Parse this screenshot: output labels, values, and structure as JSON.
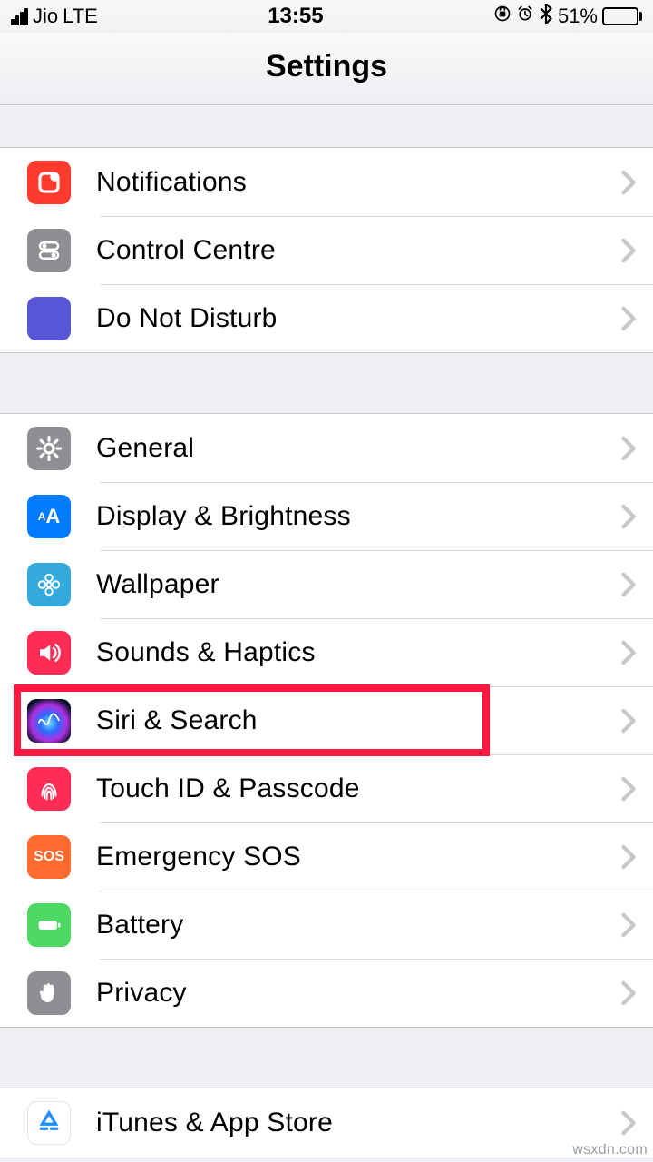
{
  "status": {
    "carrier": "Jio",
    "network": "LTE",
    "time": "13:55",
    "orientation_lock": true,
    "alarm": true,
    "bluetooth": true,
    "battery_pct": "51%"
  },
  "header": {
    "title": "Settings"
  },
  "groups": [
    {
      "rows": [
        {
          "id": "notifications",
          "label": "Notifications",
          "icon": "notifications-icon",
          "icon_bg": "bg-red"
        },
        {
          "id": "control-centre",
          "label": "Control Centre",
          "icon": "toggles-icon",
          "icon_bg": "bg-gray"
        },
        {
          "id": "do-not-disturb",
          "label": "Do Not Disturb",
          "icon": "moon-icon",
          "icon_bg": "bg-indigo"
        }
      ]
    },
    {
      "rows": [
        {
          "id": "general",
          "label": "General",
          "icon": "gear-icon",
          "icon_bg": "bg-gray"
        },
        {
          "id": "display-brightness",
          "label": "Display & Brightness",
          "icon": "aa-icon",
          "icon_bg": "bg-blue"
        },
        {
          "id": "wallpaper",
          "label": "Wallpaper",
          "icon": "flower-icon",
          "icon_bg": "bg-cyan"
        },
        {
          "id": "sounds-haptics",
          "label": "Sounds & Haptics",
          "icon": "speaker-icon",
          "icon_bg": "bg-pink"
        },
        {
          "id": "siri-search",
          "label": "Siri & Search",
          "icon": "siri-icon",
          "icon_bg": "bg-siri",
          "highlighted": true
        },
        {
          "id": "touchid-passcode",
          "label": "Touch ID & Passcode",
          "icon": "fingerprint-icon",
          "icon_bg": "bg-pink"
        },
        {
          "id": "emergency-sos",
          "label": "Emergency SOS",
          "icon": "sos-icon",
          "icon_bg": "bg-sos",
          "icon_text": "SOS"
        },
        {
          "id": "battery",
          "label": "Battery",
          "icon": "battery-icon",
          "icon_bg": "bg-green"
        },
        {
          "id": "privacy",
          "label": "Privacy",
          "icon": "hand-icon",
          "icon_bg": "bg-gray"
        }
      ]
    },
    {
      "rows": [
        {
          "id": "itunes-app-store",
          "label": "iTunes & App Store",
          "icon": "appstore-icon",
          "icon_bg": "bg-appstore"
        }
      ]
    }
  ],
  "watermark": "wsxdn.com",
  "colors": {
    "highlight_border": "#ff1840",
    "chevron": "#c7c7cc",
    "separator": "#c6c6c8"
  }
}
